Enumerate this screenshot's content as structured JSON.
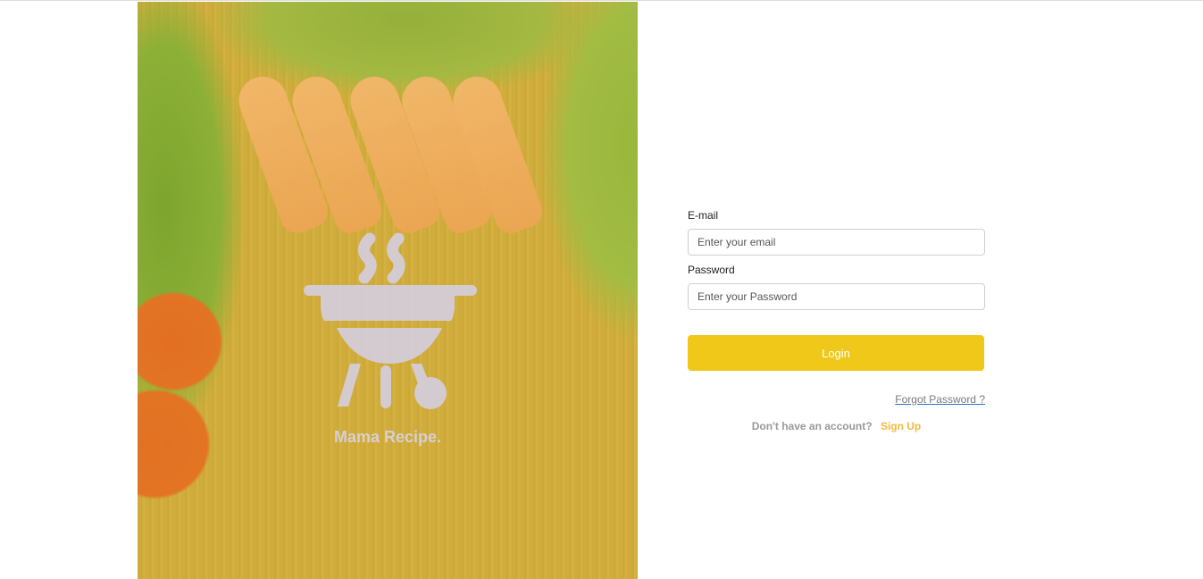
{
  "hero": {
    "logo_text": "Mama Recipe."
  },
  "form": {
    "email_label": "E-mail",
    "email_placeholder": "Enter your email",
    "password_label": "Password",
    "password_placeholder": "Enter your Password",
    "login_label": "Login",
    "forgot_label": "Forgot Password ?",
    "no_account_text": "Don't have an account?",
    "signup_label": "Sign Up"
  },
  "colors": {
    "accent": "#efc81a",
    "signup": "#f5b93b"
  }
}
